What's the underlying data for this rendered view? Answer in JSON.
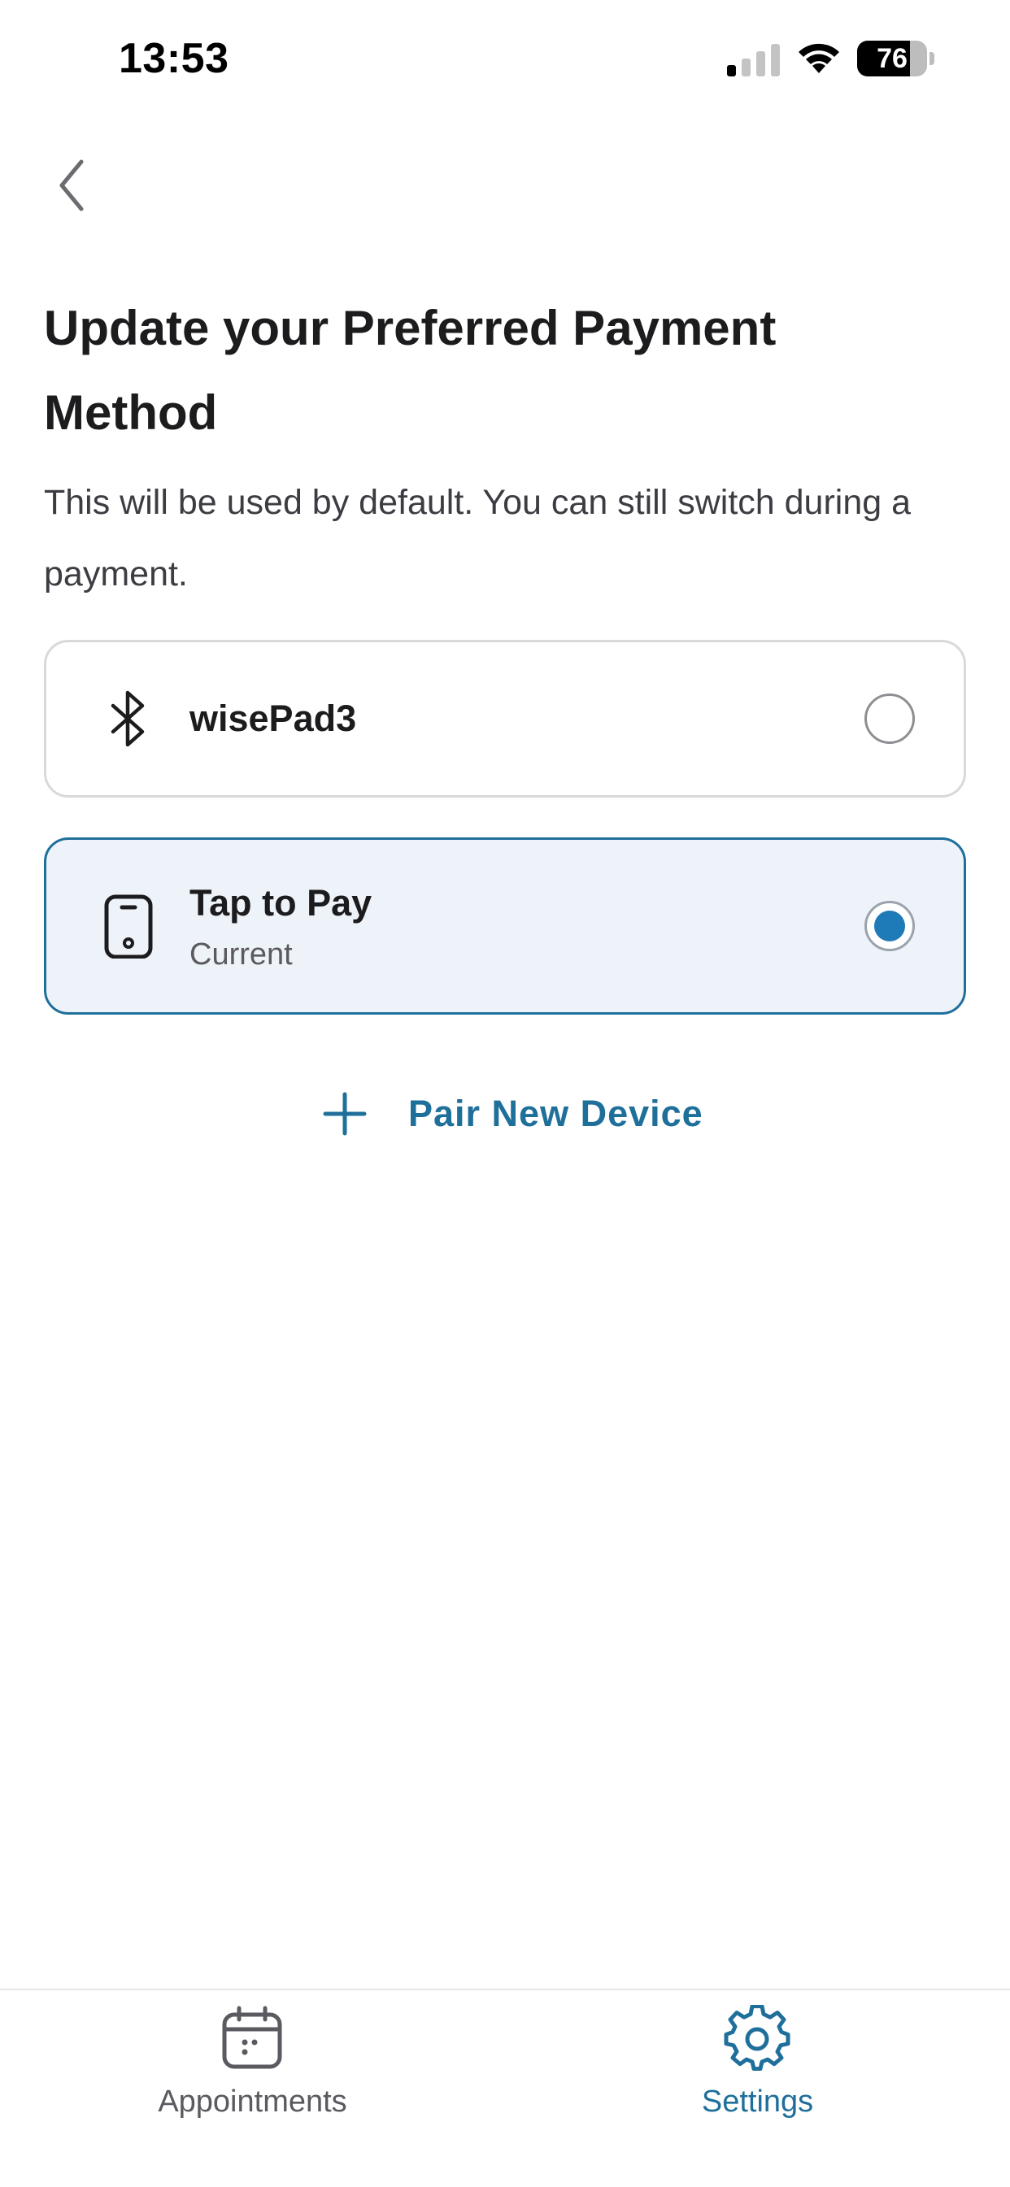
{
  "status_bar": {
    "time": "13:53",
    "battery": "76",
    "battery_level": 0.76,
    "icons": [
      "signal-icon",
      "wifi-icon",
      "battery-icon"
    ]
  },
  "header": {
    "back_icon": "chevron-left-icon",
    "title": "Update your Preferred Payment Method",
    "subtitle": "This will be used by default. You can still switch during a payment."
  },
  "payment_methods": [
    {
      "icon": "bluetooth-icon",
      "label": "wisePad3",
      "sublabel": "",
      "selected": false
    },
    {
      "icon": "phone-icon",
      "label": "Tap to Pay",
      "sublabel": "Current",
      "selected": true
    }
  ],
  "pair_device": {
    "icon": "plus-icon",
    "label": "Pair New Device"
  },
  "tab_bar": {
    "tabs": [
      {
        "icon": "calendar-icon",
        "label": "Appointments",
        "active": false
      },
      {
        "icon": "gear-icon",
        "label": "Settings",
        "active": true
      }
    ]
  },
  "colors": {
    "accent": "#1f6f9b",
    "radio_selected": "#1f7ab8",
    "selected_card_bg": "#eef3f9",
    "text_primary": "#1c1c1e",
    "text_secondary": "#3c3c43"
  }
}
